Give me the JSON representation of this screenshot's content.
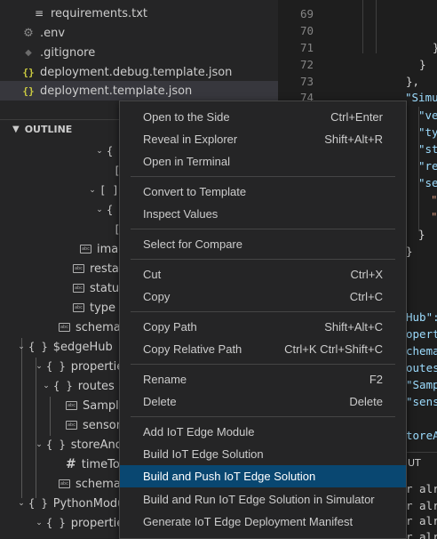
{
  "explorer": {
    "files": [
      {
        "name": "requirements.txt",
        "icon": "lines-icon"
      },
      {
        "name": ".env",
        "icon": "gear-icon"
      },
      {
        "name": ".gitignore",
        "icon": "diamond-icon"
      },
      {
        "name": "deployment.debug.template.json",
        "icon": "json-icon"
      },
      {
        "name": "deployment.template.json",
        "icon": "json-icon",
        "selected": true
      }
    ],
    "json_glyph": "{}"
  },
  "outline": {
    "title": "OUTLINE",
    "items": [
      {
        "label": "{ }",
        "kind": "object"
      },
      {
        "label": "[",
        "kind": "array-open"
      },
      {
        "label": "[ ]",
        "kind": "array"
      },
      {
        "label": "{ }",
        "kind": "object"
      },
      {
        "label": "[",
        "kind": "array-open"
      },
      {
        "label": "image",
        "kind": "string"
      },
      {
        "label": "restartPolicy",
        "kind": "string"
      },
      {
        "label": "status",
        "kind": "string"
      },
      {
        "label": "type",
        "kind": "string"
      },
      {
        "label": "schemaVersion",
        "kind": "string"
      },
      {
        "label": "$edgeHub",
        "kind": "object"
      },
      {
        "label": "properties.desired",
        "kind": "object"
      },
      {
        "label": "routes",
        "kind": "object"
      },
      {
        "label": "SampleModuleToIoTHub",
        "kind": "string"
      },
      {
        "label": "sensorToSampleModule",
        "kind": "string"
      },
      {
        "label": "storeAndForwardConfiguration",
        "kind": "object"
      },
      {
        "label": "timeToLiveSecs",
        "kind": "number"
      },
      {
        "label": "schemaVersion",
        "kind": "string"
      },
      {
        "label": "PythonModule",
        "kind": "object"
      },
      {
        "label": "properties.desired",
        "kind": "object"
      }
    ]
  },
  "editor": {
    "line_numbers": [
      "69",
      "70",
      "71",
      "72",
      "73",
      "74"
    ],
    "lines": [
      {
        "text": "}"
      },
      {
        "text": "},"
      },
      {
        "text": "\"Simul"
      },
      {
        "text": "\"ve"
      },
      {
        "text": "\"ty"
      },
      {
        "text": "\"st"
      },
      {
        "text": "\"re"
      },
      {
        "text": "\"se"
      },
      {
        "text": "\""
      },
      {
        "text": "\""
      },
      {
        "text": "}"
      },
      {
        "text": "}"
      },
      {
        "text": "Hub\":"
      },
      {
        "text": "operti"
      },
      {
        "text": "chema"
      },
      {
        "text": "outes"
      },
      {
        "text": "\"Samp"
      },
      {
        "text": "\"sens"
      },
      {
        "text": "toreA"
      }
    ],
    "panel_label": "UT",
    "terminal_lines": [
      "r alr",
      "r alr",
      "r alr",
      "r alr"
    ]
  },
  "context_menu": {
    "groups": [
      [
        {
          "label": "Open to the Side",
          "shortcut": "Ctrl+Enter"
        },
        {
          "label": "Reveal in Explorer",
          "shortcut": "Shift+Alt+R"
        },
        {
          "label": "Open in Terminal",
          "shortcut": ""
        }
      ],
      [
        {
          "label": "Convert to Template",
          "shortcut": ""
        },
        {
          "label": "Inspect Values",
          "shortcut": ""
        }
      ],
      [
        {
          "label": "Select for Compare",
          "shortcut": ""
        }
      ],
      [
        {
          "label": "Cut",
          "shortcut": "Ctrl+X"
        },
        {
          "label": "Copy",
          "shortcut": "Ctrl+C"
        }
      ],
      [
        {
          "label": "Copy Path",
          "shortcut": "Shift+Alt+C"
        },
        {
          "label": "Copy Relative Path",
          "shortcut": "Ctrl+K Ctrl+Shift+C"
        }
      ],
      [
        {
          "label": "Rename",
          "shortcut": "F2"
        },
        {
          "label": "Delete",
          "shortcut": "Delete"
        }
      ],
      [
        {
          "label": "Add IoT Edge Module",
          "shortcut": ""
        },
        {
          "label": "Build IoT Edge Solution",
          "shortcut": ""
        },
        {
          "label": "Build and Push IoT Edge Solution",
          "shortcut": "",
          "active": true
        },
        {
          "label": "Build and Run IoT Edge Solution in Simulator",
          "shortcut": ""
        },
        {
          "label": "Generate IoT Edge Deployment Manifest",
          "shortcut": ""
        }
      ]
    ]
  },
  "colors": {
    "sidebar_bg": "#252526",
    "editor_bg": "#1e1e1e",
    "menu_active": "#094771",
    "json_icon": "#cbcb41",
    "key_color": "#9cdcfe",
    "string_color": "#ce9178"
  }
}
